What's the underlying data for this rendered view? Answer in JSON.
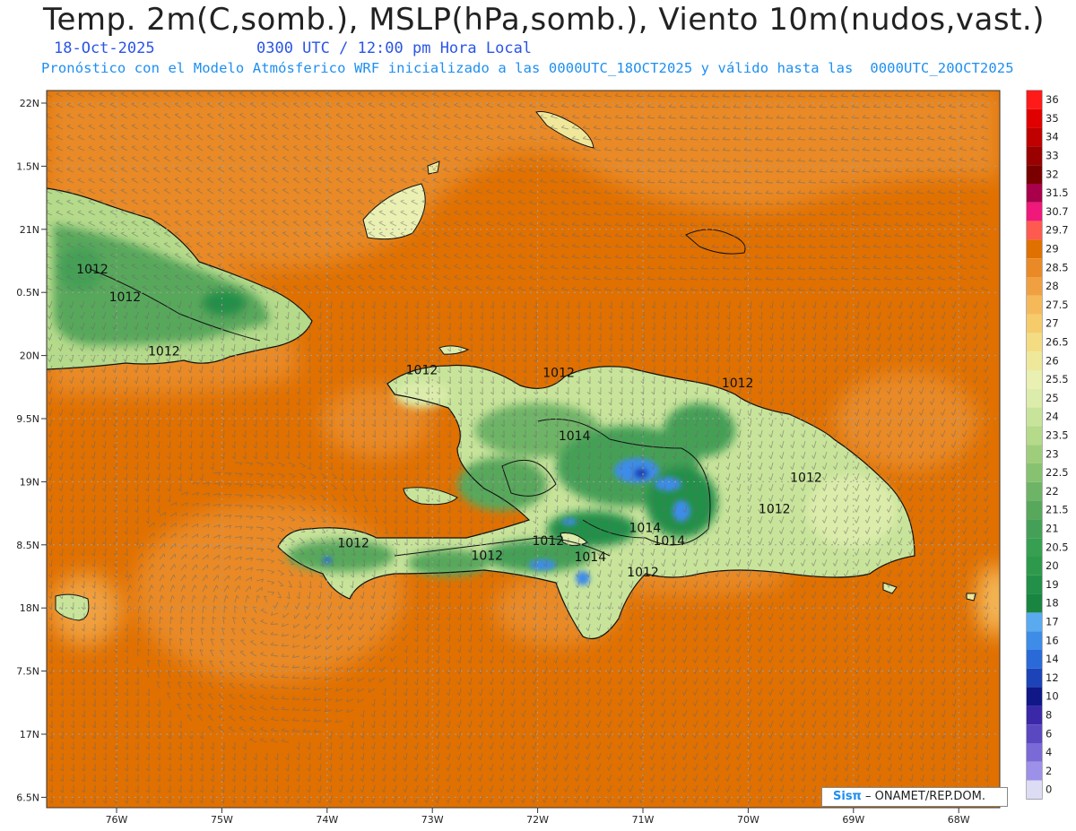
{
  "header": {
    "title": "Temp. 2m(C,somb.), MSLP(hPa,somb.), Viento 10m(nudos,vast.)",
    "date": "18-Oct-2025",
    "time": "0300 UTC / 12:00 pm Hora Local",
    "subtitle": "Pronóstico con el Modelo Atmósferico WRF inicializado a las 0000UTC_18OCT2025 y válido hasta las  0000UTC_20OCT2025"
  },
  "map": {
    "lat_ticks": [
      "22N",
      "1.5N",
      "21N",
      "0.5N",
      "20N",
      "9.5N",
      "19N",
      "8.5N",
      "18N",
      "7.5N",
      "17N",
      "6.5N"
    ],
    "lon_ticks": [
      "76W",
      "75W",
      "74W",
      "73W",
      "72W",
      "71W",
      "70W",
      "69W",
      "68W"
    ],
    "isobar_labels": [
      {
        "text": "1012",
        "lon": -76.23,
        "lat": 20.65
      },
      {
        "text": "1012",
        "lon": -75.92,
        "lat": 20.43
      },
      {
        "text": "1012",
        "lon": -75.55,
        "lat": 20.0
      },
      {
        "text": "1012",
        "lon": -73.1,
        "lat": 19.85
      },
      {
        "text": "1012",
        "lon": -71.8,
        "lat": 19.83
      },
      {
        "text": "1012",
        "lon": -70.1,
        "lat": 19.75
      },
      {
        "text": "1014",
        "lon": -71.65,
        "lat": 19.33
      },
      {
        "text": "1012",
        "lon": -69.45,
        "lat": 19.0
      },
      {
        "text": "1012",
        "lon": -69.75,
        "lat": 18.75
      },
      {
        "text": "1012",
        "lon": -73.75,
        "lat": 18.48
      },
      {
        "text": "1012",
        "lon": -72.48,
        "lat": 18.38
      },
      {
        "text": "1012",
        "lon": -71.9,
        "lat": 18.5
      },
      {
        "text": "1014",
        "lon": -71.5,
        "lat": 18.37
      },
      {
        "text": "1014",
        "lon": -70.98,
        "lat": 18.6
      },
      {
        "text": "1014",
        "lon": -70.75,
        "lat": 18.5
      },
      {
        "text": "1012",
        "lon": -71.0,
        "lat": 18.25
      }
    ]
  },
  "colorbar": {
    "labels": [
      "36",
      "35",
      "34",
      "33",
      "32",
      "31.5",
      "30.7",
      "29.7",
      "29",
      "28.5",
      "28",
      "27.5",
      "27",
      "26.5",
      "26",
      "25.5",
      "25",
      "24",
      "23.5",
      "23",
      "22.5",
      "22",
      "21.5",
      "21",
      "20.5",
      "20",
      "19",
      "18",
      "17",
      "16",
      "14",
      "12",
      "10",
      "8",
      "6",
      "4",
      "2",
      "0"
    ],
    "colors": [
      "#ff1a1a",
      "#e00000",
      "#c00000",
      "#9a0000",
      "#7a0000",
      "#a8004a",
      "#f0187a",
      "#ff5a50",
      "#e07000",
      "#e98a26",
      "#f0a040",
      "#f5b95a",
      "#f6cb6a",
      "#f3dc82",
      "#efe89a",
      "#e9f0b2",
      "#dcecaa",
      "#c8e49a",
      "#b4da8a",
      "#9ece7c",
      "#86c270",
      "#6eb466",
      "#58a85c",
      "#44a056",
      "#36a050",
      "#2c9a4a",
      "#229048",
      "#188640",
      "#5aaaf0",
      "#3c8ce8",
      "#2a6ad8",
      "#1c44b8",
      "#101888",
      "#3a28a8",
      "#5a48c0",
      "#7a6ad8",
      "#9c90e8",
      "#dcdcf4"
    ]
  },
  "credit": {
    "brand": "Sisπ",
    "text": " – ONAMET/REP.DOM."
  }
}
